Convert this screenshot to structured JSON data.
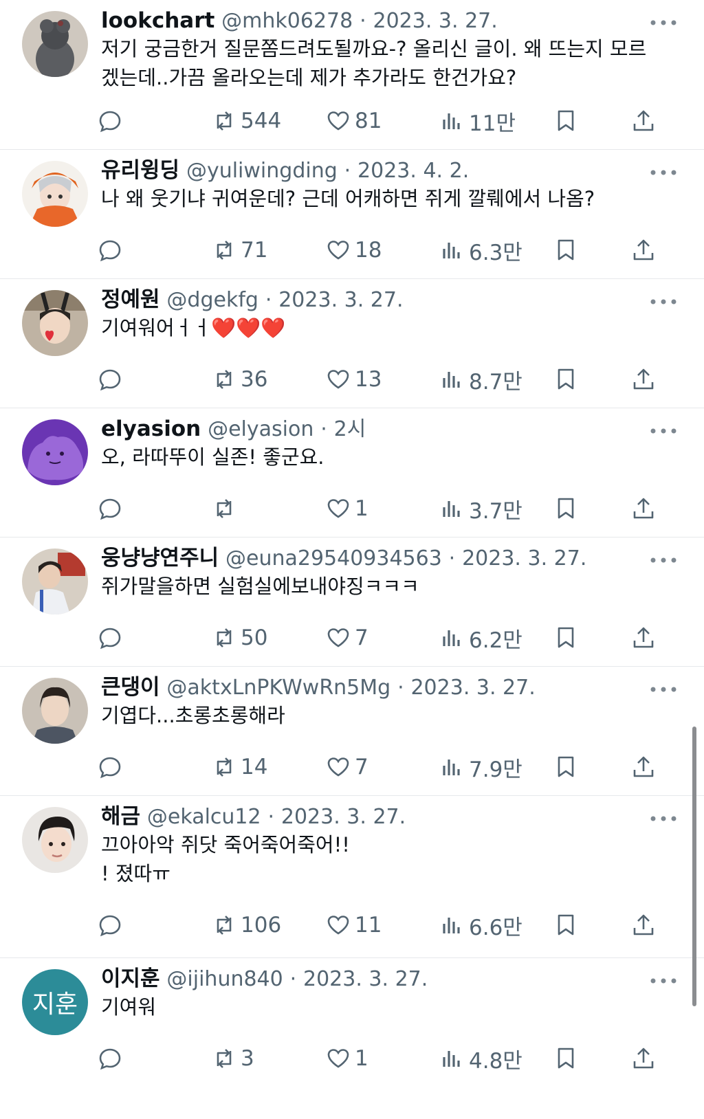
{
  "tweets": [
    {
      "name": "lookchart",
      "handle": "@mhk06278",
      "sep": "·",
      "time": "2023. 3. 27.",
      "text": "저기 궁금한거 질문쫌드려도될까요-? 올리신 글이. 왜 뜨는지 모르\n겠는데..가끔 올라오는데 제가 추가라도 한건가요?",
      "retweets": "544",
      "likes": "81",
      "views": "11만",
      "avatar": "poodle-avatar"
    },
    {
      "name": "유리윙딩",
      "handle": "@yuliwingding",
      "sep": "·",
      "time": "2023. 4. 2.",
      "text": "나 왜 웃기냐 귀여운데? 근데 어캐하면 쥐게 깔뤠에서 나옴?",
      "retweets": "71",
      "likes": "18",
      "views": "6.3만",
      "avatar": "anime-avatar"
    },
    {
      "name": "정예원",
      "handle": "@dgekfg",
      "sep": "·",
      "time": "2023. 3. 27.",
      "text": "기여워어ㅓㅓ",
      "emoji_hearts": "❤️❤️❤️",
      "retweets": "36",
      "likes": "13",
      "views": "8.7만",
      "avatar": "selfie-avatar"
    },
    {
      "name": "elyasion",
      "handle": "@elyasion",
      "sep": "·",
      "time": "2시",
      "text": "오, 라따뚜이 실존! 좋군요.",
      "retweets": "",
      "likes": "1",
      "views": "3.7만",
      "avatar": "ditto-avatar"
    },
    {
      "name": "웅냥냥연주니",
      "handle": "@euna29540934563",
      "sep": "·",
      "time": "2023. 3. 27.",
      "text": "쥐가말을하면 실험실에보내야징ㅋㅋㅋ",
      "retweets": "50",
      "likes": "7",
      "views": "6.2만",
      "avatar": "person-avatar"
    },
    {
      "name": "큰댕이",
      "handle": "@aktxLnPKWwRn5Mg",
      "sep": "·",
      "time": "2023. 3. 27.",
      "text": "기엽다...초롱초롱해라",
      "retweets": "14",
      "likes": "7",
      "views": "7.9만",
      "avatar": "portrait-avatar"
    },
    {
      "name": "해금",
      "handle": "@ekalcu12",
      "sep": "·",
      "time": "2023. 3. 27.",
      "text": "끄아아악 쥐닷 죽어죽어죽어!!\n! 졌따ㅠ",
      "retweets": "106",
      "likes": "11",
      "views": "6.6만",
      "avatar": "drawn-portrait-avatar"
    },
    {
      "name": "이지훈",
      "handle": "@ijihun840",
      "sep": "·",
      "time": "2023. 3. 27.",
      "text": "기여워",
      "retweets": "3",
      "likes": "1",
      "views": "4.8만",
      "avatar": "initials-avatar",
      "avatar_text": "지훈"
    }
  ],
  "colors": {
    "text": "#0f1419",
    "muted": "#536471",
    "divider": "#e6e8eb",
    "initials_bg": "#2c8c98"
  },
  "icons": [
    "reply-icon",
    "retweet-icon",
    "like-icon",
    "views-icon",
    "bookmark-icon",
    "share-icon",
    "more-icon"
  ]
}
